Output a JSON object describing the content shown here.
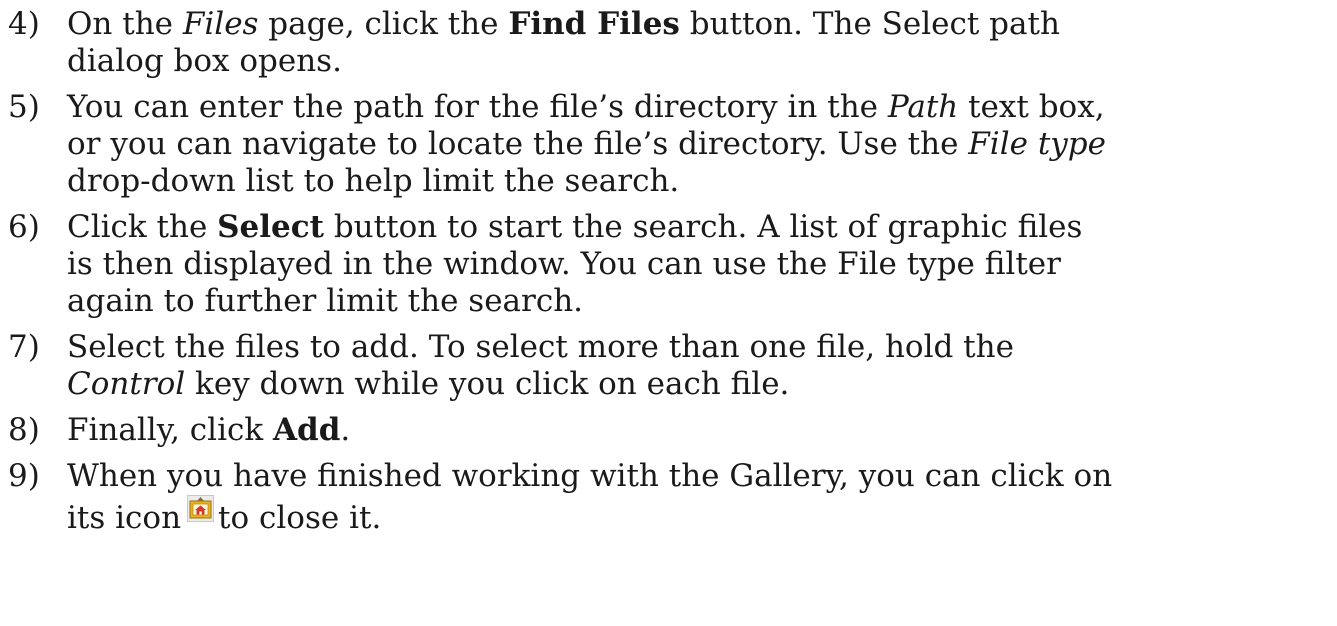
{
  "steps": [
    {
      "number": "4)",
      "t1": "On the ",
      "t2": "Files",
      "t3": " page, click the ",
      "t4": "Find Files",
      "t5": " button. The Select path",
      "t6": "dialog box opens."
    },
    {
      "number": "5)",
      "t1": "You can enter the path for the file’s directory in the ",
      "t2": "Path",
      "t3": " text box,",
      "t4": "or you can navigate to locate the file’s directory. Use the ",
      "t5": "File type",
      "t6": "drop-down list to help limit the search."
    },
    {
      "number": "6)",
      "t1": "Click the ",
      "t2": "Select",
      "t3": " button to start the search. A list of graphic files",
      "t4": "is then displayed in the window. You can use the File type filter",
      "t5": "again to further limit the search."
    },
    {
      "number": "7)",
      "t1": "Select the files to add. To select more than one file, hold the",
      "t2": "Control",
      "t3": " key down while you click on each file."
    },
    {
      "number": "8)",
      "t1": "Finally, click ",
      "t2": "Add",
      "t3": "."
    },
    {
      "number": "9)",
      "t1": "When you have finished working with the Gallery, you can click on",
      "t2": "its icon",
      "icon": "gallery-icon",
      "t3": "to close it."
    }
  ]
}
